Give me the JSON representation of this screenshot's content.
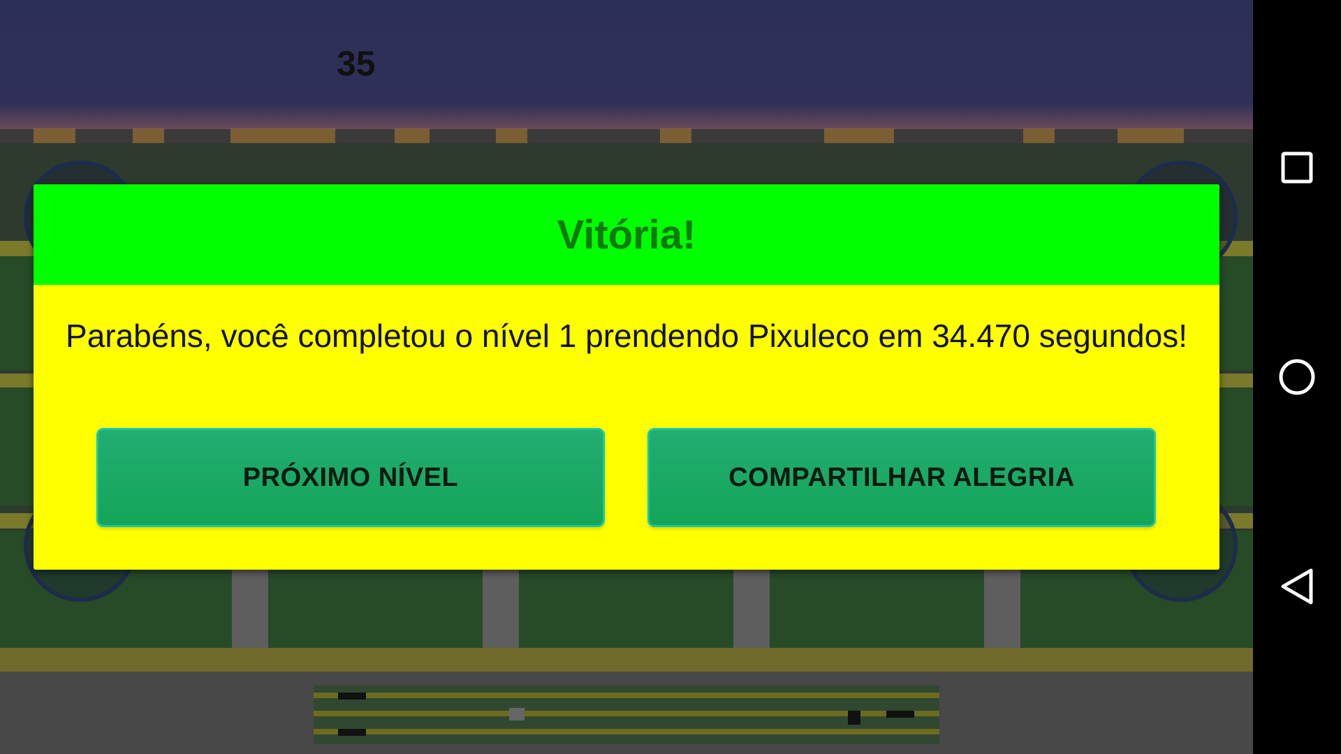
{
  "hud": {
    "score": "35"
  },
  "dialog": {
    "title": "Vitória!",
    "message": "Parabéns, você completou o nível 1 prendendo Pixuleco em 34.470 segundos!",
    "buttons": {
      "next_level": "PRÓXIMO NÍVEL",
      "share": "COMPARTILHAR ALEGRIA"
    }
  },
  "navbar": {
    "icons": [
      "recents-square-icon",
      "home-circle-icon",
      "back-triangle-icon"
    ]
  },
  "colors": {
    "dialog_header": "#00ff00",
    "dialog_body": "#ffff00",
    "title_text": "#0d7a0d",
    "button": "#1aaa66",
    "button_border": "#19c8a8",
    "sky": "#2c2f57"
  }
}
